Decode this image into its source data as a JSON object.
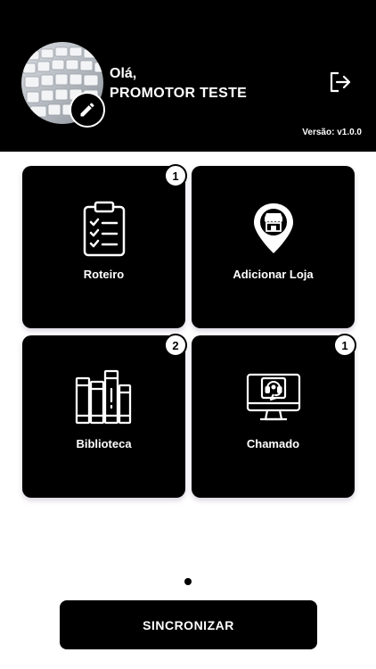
{
  "header": {
    "greeting": "Olá,",
    "user_name": "PROMOTOR TESTE",
    "version": "Versão: v1.0.0",
    "edit_icon": "pencil-icon",
    "logout_icon": "logout-icon",
    "background_color": "#000000"
  },
  "menu": [
    {
      "label": "Roteiro",
      "icon": "clipboard-checklist-icon",
      "badge": "1"
    },
    {
      "label": "Adicionar Loja",
      "icon": "store-location-icon",
      "badge": ""
    },
    {
      "label": "Biblioteca",
      "icon": "books-icon",
      "badge": "2"
    },
    {
      "label": "Chamado",
      "icon": "support-headset-icon",
      "badge": "1"
    }
  ],
  "pager": {
    "current_page": 1,
    "total_pages": 1
  },
  "sync_button": {
    "label": "SINCRONIZAR"
  }
}
